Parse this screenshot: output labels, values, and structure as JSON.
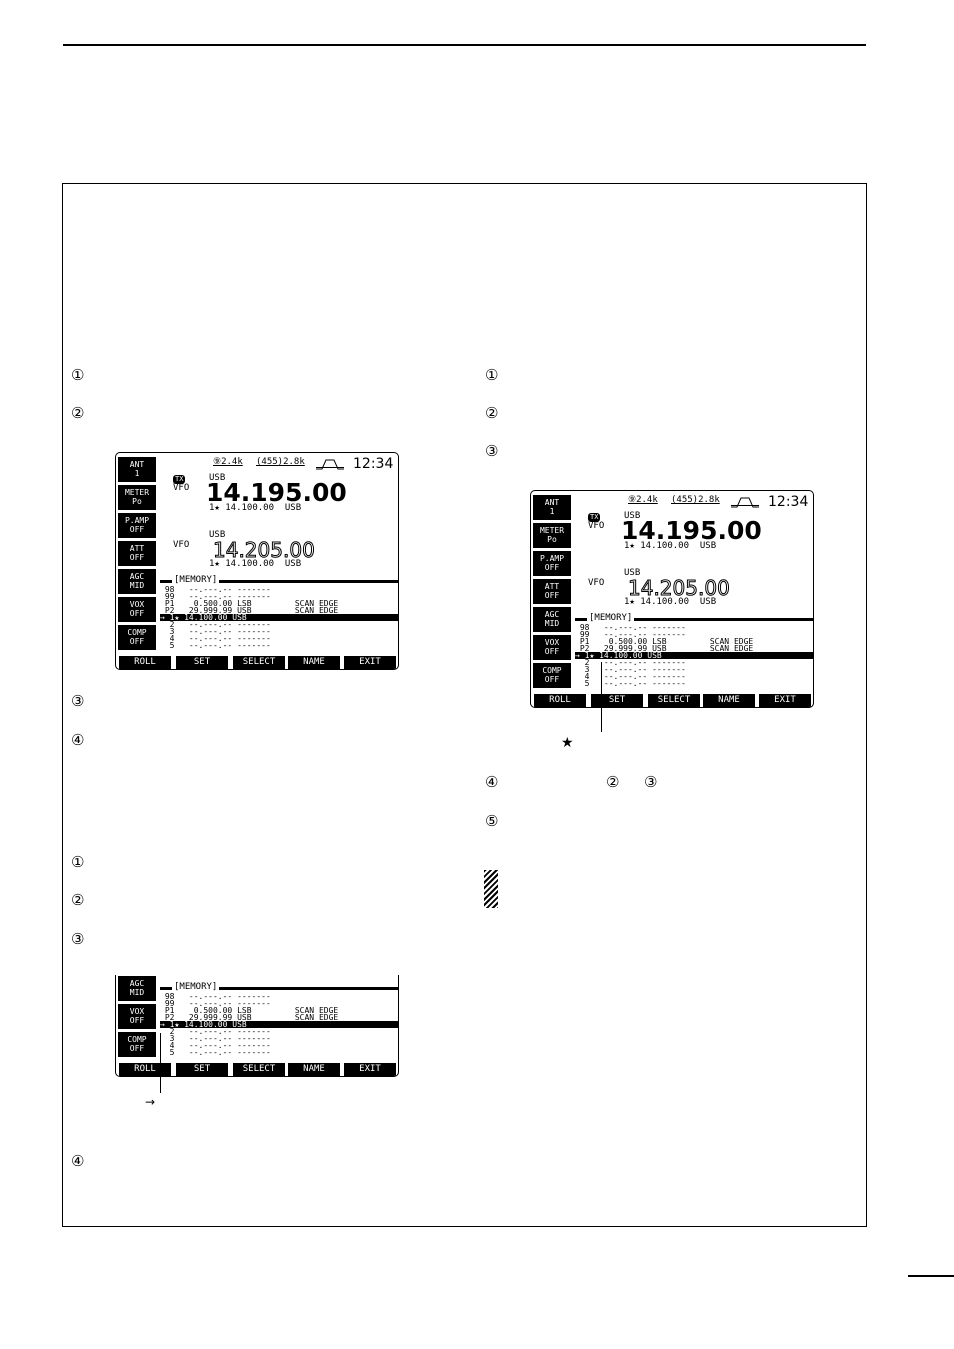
{
  "step_markers_left": [
    "①",
    "②",
    "③",
    "④",
    "①",
    "②",
    "③",
    "④"
  ],
  "step_markers_right": [
    "①",
    "②",
    "③",
    "④",
    "②",
    "③",
    "⑤"
  ],
  "annotations": {
    "pointer_symbol": "→",
    "star_symbol": "★"
  },
  "lcd": {
    "softkeys": [
      [
        "ANT",
        "1"
      ],
      [
        "METER",
        "Po"
      ],
      [
        "P.AMP",
        "OFF"
      ],
      [
        "ATT",
        "OFF"
      ],
      [
        "AGC",
        "MID"
      ],
      [
        "VOX",
        "OFF"
      ],
      [
        "COMP",
        "OFF"
      ]
    ],
    "bottom_keys": [
      "ROLL",
      "SET",
      "SELECT",
      "NAME",
      "EXIT"
    ],
    "filter1": "⑨2.4k",
    "filter2": "(455)2.8k",
    "clock": "12:34",
    "tx_badge": "TX",
    "main": {
      "mode": "USB",
      "vfo": "VFO",
      "freq": "14.195.00",
      "sub": "1★ 14.100.00  USB"
    },
    "second": {
      "mode": "USB",
      "vfo": "VFO",
      "freq": "14.205.00",
      "sub": "1★ 14.100.00  USB"
    },
    "memory_title": "[MEMORY]",
    "rows": [
      " 98   --.---.-- -------",
      " 99   --.---.-- -------",
      " P1    0.500.00 LSB         SCAN EDGE",
      " P2   29.999.99 USB         SCAN EDGE",
      "→ 1★ 14.100.00 USB",
      "  2   --.---.-- -------",
      "  3   --.---.-- -------",
      "  4   --.---.-- -------",
      "  5   --.---.-- -------"
    ]
  }
}
